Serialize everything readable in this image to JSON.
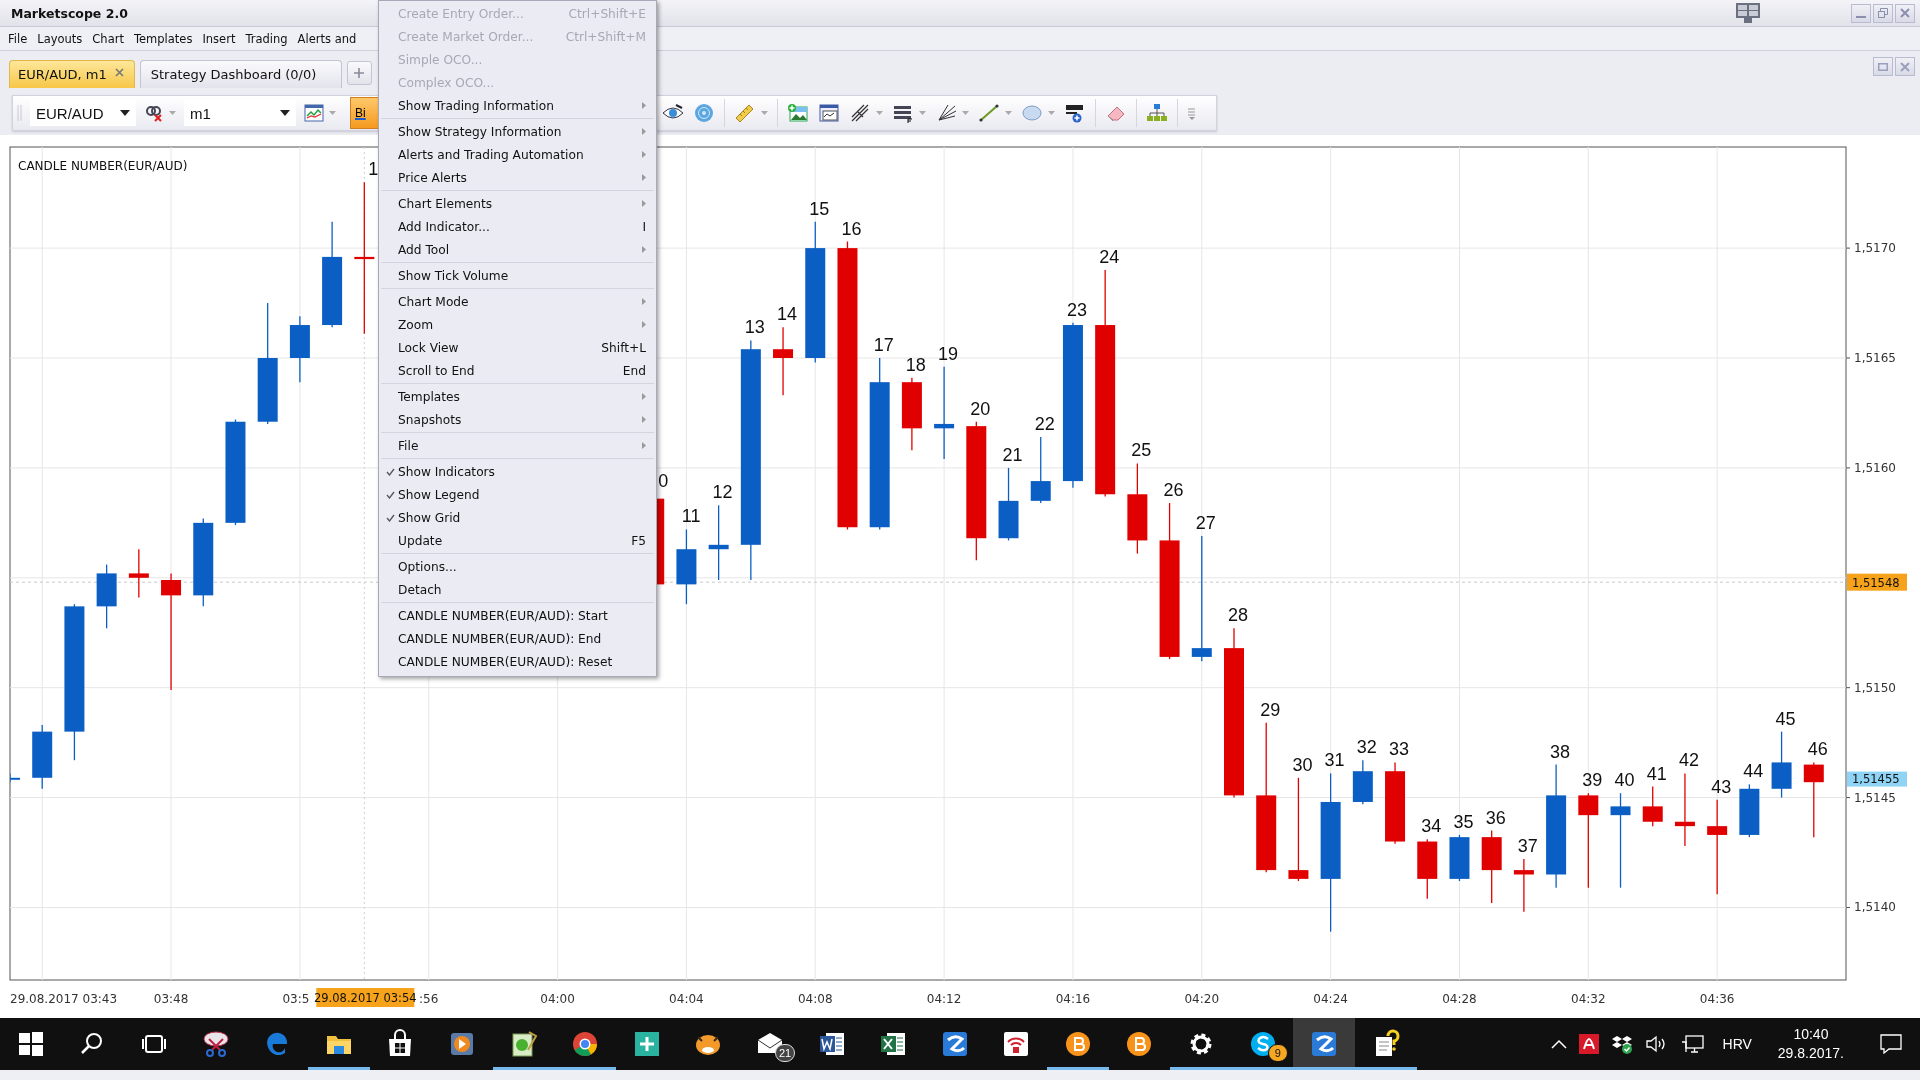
{
  "window": {
    "title": "Marketscope 2.0"
  },
  "menu_bar": [
    "File",
    "Layouts",
    "Chart",
    "Templates",
    "Insert",
    "Trading",
    "Alerts and"
  ],
  "tabs": [
    {
      "label": "EUR/AUD, m1",
      "selected": true,
      "closable": true
    },
    {
      "label": "Strategy Dashboard (0/0)",
      "selected": false,
      "closable": false
    }
  ],
  "toolbar": {
    "symbol": "EUR/AUD",
    "timeframe": "m1",
    "price_button": "Bi",
    "tool_groups": [
      [
        {
          "kind": "eye",
          "dropdown": false
        },
        {
          "kind": "radar",
          "dropdown": false
        }
      ],
      [
        {
          "kind": "ruler",
          "dropdown": true
        }
      ],
      [
        {
          "kind": "image-add",
          "dropdown": false
        },
        {
          "kind": "chart-window",
          "dropdown": false
        },
        {
          "kind": "pitchfork",
          "dropdown": true
        },
        {
          "kind": "lines",
          "dropdown": true
        },
        {
          "kind": "fan",
          "dropdown": true
        },
        {
          "kind": "line",
          "dropdown": true
        },
        {
          "kind": "ellipse",
          "dropdown": true
        },
        {
          "kind": "text-add",
          "dropdown": false
        }
      ],
      [
        {
          "kind": "eraser",
          "dropdown": false
        }
      ],
      [
        {
          "kind": "hierarchy",
          "dropdown": false
        }
      ]
    ]
  },
  "chart": {
    "legend": "CANDLE NUMBER(EUR/AUD)",
    "candle_numbers": [
      "1",
      "0",
      "11",
      "12",
      "13",
      "14",
      "15",
      "16",
      "17",
      "18",
      "19",
      "20",
      "21",
      "22",
      "23",
      "24",
      "25",
      "26",
      "27",
      "28",
      "29",
      "30",
      "31",
      "32",
      "33",
      "34",
      "35",
      "36",
      "37",
      "38",
      "39",
      "40",
      "41",
      "42",
      "43",
      "44",
      "45",
      "46"
    ],
    "price_labels": [
      "1,5170",
      "1,5165",
      "1,5160",
      "1,5150",
      "1,5145",
      "1,5140"
    ],
    "time_labels": [
      "29.08.2017 03:43",
      "03:48",
      "03:5",
      ":56",
      "04:00",
      "04:04",
      "04:08",
      "04:12",
      "04:16",
      "04:20",
      "04:24",
      "04:28",
      "04:32",
      "04:36"
    ],
    "crosshair_price": "1,51548",
    "last_price": "1,51455",
    "crosshair_time": "29.08.2017 03:54"
  },
  "context_menu": {
    "groups": [
      [
        {
          "label": "Create Entry Order...",
          "shortcut": "Ctrl+Shift+E",
          "submenu": false,
          "disabled": true,
          "checked": false
        },
        {
          "label": "Create Market Order...",
          "shortcut": "Ctrl+Shift+M",
          "submenu": false,
          "disabled": true,
          "checked": false
        },
        {
          "label": "Simple OCO...",
          "submenu": false,
          "disabled": true,
          "checked": false
        },
        {
          "label": "Complex OCO...",
          "submenu": false,
          "disabled": true,
          "checked": false
        },
        {
          "label": "Show Trading Information",
          "submenu": true,
          "disabled": false,
          "checked": false
        }
      ],
      [
        {
          "label": "Show Strategy Information",
          "submenu": true,
          "disabled": false,
          "checked": false
        },
        {
          "label": "Alerts and Trading Automation",
          "submenu": true,
          "disabled": false,
          "checked": false
        },
        {
          "label": "Price Alerts",
          "submenu": true,
          "disabled": false,
          "checked": false
        }
      ],
      [
        {
          "label": "Chart Elements",
          "submenu": true,
          "disabled": false,
          "checked": false
        },
        {
          "label": "Add Indicator...",
          "shortcut": "I",
          "submenu": false,
          "disabled": false,
          "checked": false
        },
        {
          "label": "Add Tool",
          "submenu": true,
          "disabled": false,
          "checked": false
        }
      ],
      [
        {
          "label": "Show Tick Volume",
          "submenu": false,
          "disabled": false,
          "checked": false
        }
      ],
      [
        {
          "label": "Chart Mode",
          "submenu": true,
          "disabled": false,
          "checked": false
        },
        {
          "label": "Zoom",
          "submenu": true,
          "disabled": false,
          "checked": false
        },
        {
          "label": "Lock View",
          "shortcut": "Shift+L",
          "submenu": false,
          "disabled": false,
          "checked": false
        },
        {
          "label": "Scroll to End",
          "shortcut": "End",
          "submenu": false,
          "disabled": false,
          "checked": false
        }
      ],
      [
        {
          "label": "Templates",
          "submenu": true,
          "disabled": false,
          "checked": false
        },
        {
          "label": "Snapshots",
          "submenu": true,
          "disabled": false,
          "checked": false
        }
      ],
      [
        {
          "label": "File",
          "submenu": true,
          "disabled": false,
          "checked": false
        }
      ],
      [
        {
          "label": "Show Indicators",
          "submenu": false,
          "disabled": false,
          "checked": true
        },
        {
          "label": "Show Legend",
          "submenu": false,
          "disabled": false,
          "checked": true
        },
        {
          "label": "Show Grid",
          "submenu": false,
          "disabled": false,
          "checked": true
        },
        {
          "label": "Update",
          "shortcut": "F5",
          "submenu": false,
          "disabled": false,
          "checked": false
        }
      ],
      [
        {
          "label": "Options...",
          "submenu": false,
          "disabled": false,
          "checked": false
        },
        {
          "label": "Detach",
          "submenu": false,
          "disabled": false,
          "checked": false
        }
      ],
      [
        {
          "label": "CANDLE NUMBER(EUR/AUD): Start",
          "submenu": false,
          "disabled": false,
          "checked": false
        },
        {
          "label": "CANDLE NUMBER(EUR/AUD): End",
          "submenu": false,
          "disabled": false,
          "checked": false
        },
        {
          "label": "CANDLE NUMBER(EUR/AUD): Reset",
          "submenu": false,
          "disabled": false,
          "checked": false
        }
      ]
    ]
  },
  "taskbar": {
    "apps": [
      {
        "kind": "start",
        "running": false,
        "active": false
      },
      {
        "kind": "search",
        "running": false,
        "active": false
      },
      {
        "kind": "task-view",
        "running": false,
        "active": false
      },
      {
        "kind": "scissors",
        "running": false,
        "active": false
      },
      {
        "kind": "edge",
        "running": false,
        "active": false
      },
      {
        "kind": "folder",
        "running": true,
        "active": false
      },
      {
        "kind": "store",
        "running": false,
        "active": false
      },
      {
        "kind": "media",
        "running": false,
        "active": false
      },
      {
        "kind": "notepad",
        "running": true,
        "active": false
      },
      {
        "kind": "chrome",
        "running": true,
        "active": false
      },
      {
        "kind": "plus",
        "running": false,
        "active": false
      },
      {
        "kind": "tiger",
        "running": false,
        "active": false
      },
      {
        "kind": "mail",
        "running": false,
        "active": false,
        "badge": "21"
      },
      {
        "kind": "word",
        "running": false,
        "active": false
      },
      {
        "kind": "excel",
        "running": false,
        "active": false
      },
      {
        "kind": "zapp",
        "running": false,
        "active": false
      },
      {
        "kind": "vpn",
        "running": false,
        "active": false
      },
      {
        "kind": "coin",
        "running": true,
        "active": false
      },
      {
        "kind": "coin",
        "running": false,
        "active": false
      },
      {
        "kind": "gear",
        "running": true,
        "active": false
      },
      {
        "kind": "skype",
        "running": true,
        "active": false,
        "badge": "9"
      },
      {
        "kind": "zapp",
        "running": true,
        "active": true
      },
      {
        "kind": "note",
        "running": true,
        "active": false
      }
    ],
    "tray": {
      "language": "HRV",
      "time": "10:40",
      "date": "29.8.2017."
    }
  }
}
